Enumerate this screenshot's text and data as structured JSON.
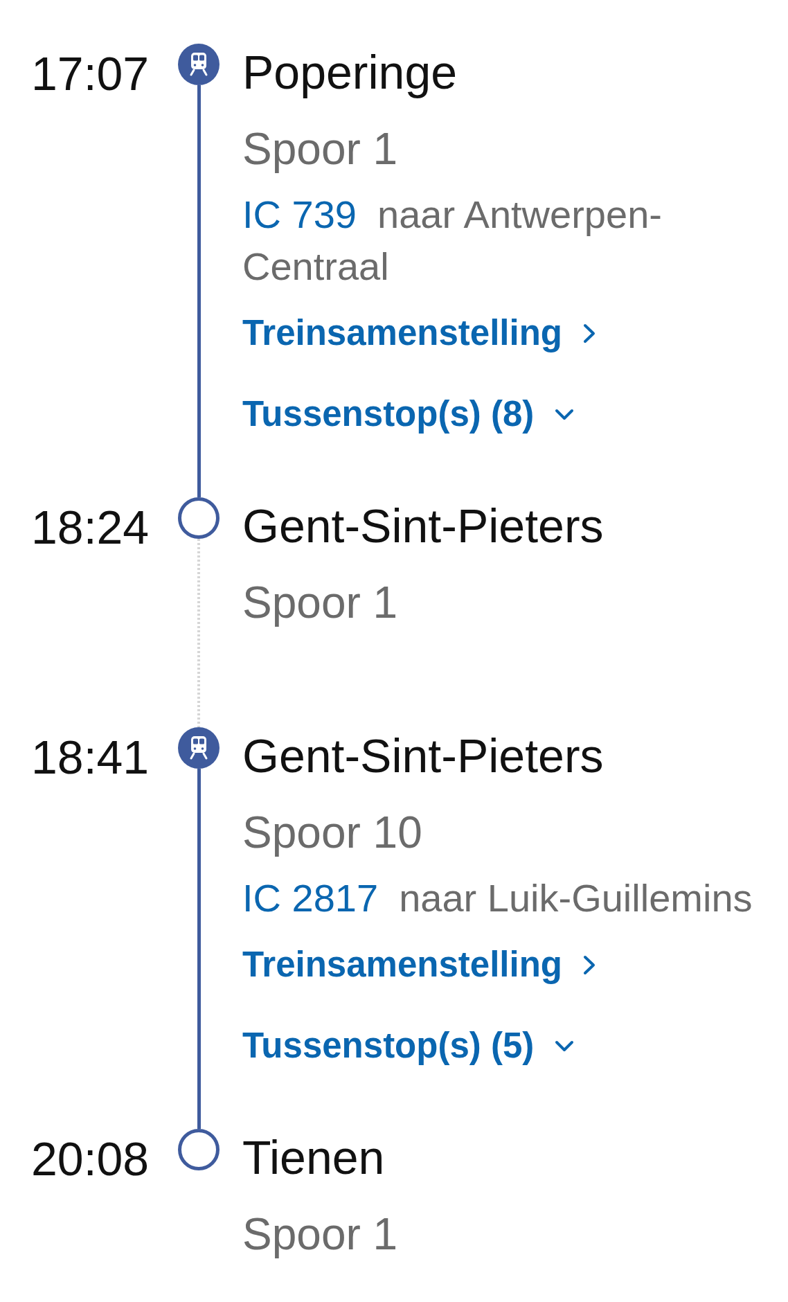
{
  "stops": [
    {
      "kind": "departure",
      "time": "17:07",
      "station": "Poperinge",
      "platform": "Spoor 1",
      "train": {
        "number": "IC 739",
        "direction": "naar Antwerpen-Centraal"
      },
      "composition_link": "Treinsamenstelling",
      "stops_toggle": {
        "label": "Tussenstop(s) (8)",
        "expanded": false
      }
    },
    {
      "kind": "arrival",
      "time": "18:24",
      "station": "Gent-Sint-Pieters",
      "platform": "Spoor 1"
    },
    {
      "kind": "departure",
      "time": "18:41",
      "station": "Gent-Sint-Pieters",
      "platform": "Spoor 10",
      "train": {
        "number": "IC 2817",
        "direction": "naar Luik-Guillemins"
      },
      "composition_link": "Treinsamenstelling",
      "stops_toggle": {
        "label": "Tussenstop(s) (5)",
        "expanded": false
      }
    },
    {
      "kind": "arrival",
      "time": "20:08",
      "station": "Tienen",
      "platform": "Spoor 1"
    }
  ]
}
